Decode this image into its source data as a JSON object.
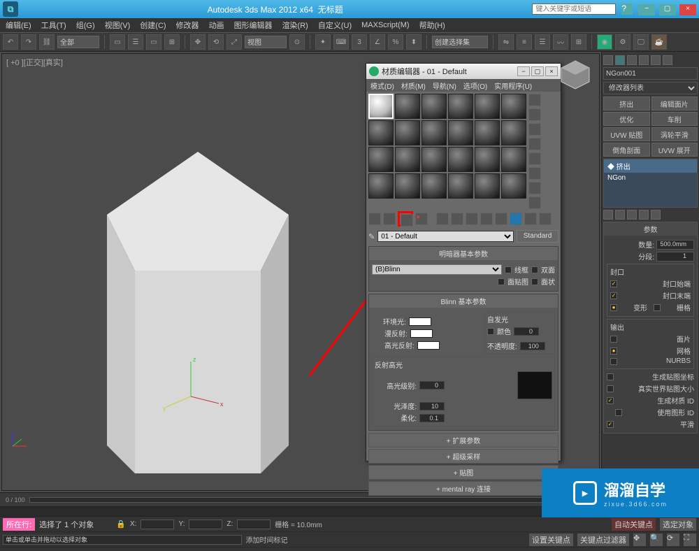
{
  "titlebar": {
    "app": "Autodesk 3ds Max  2012 x64",
    "doc": "无标题",
    "search_placeholder": "键入关键字或短语"
  },
  "menu": [
    "编辑(E)",
    "工具(T)",
    "组(G)",
    "视图(V)",
    "创建(C)",
    "修改器",
    "动画",
    "图形编辑器",
    "渲染(R)",
    "自定义(U)",
    "MAXScript(M)",
    "帮助(H)"
  ],
  "toolbar": {
    "selset_label": "全部",
    "dropdown": "创建选择集",
    "view_btn": "视图"
  },
  "viewport": {
    "label": "[ +0 ][正交][真实]"
  },
  "side": {
    "objname": "NGon001",
    "modlist_label": "修改器列表",
    "btns": [
      [
        "挤出",
        "编辑面片"
      ],
      [
        "优化",
        "车削"
      ],
      [
        "UVW 贴图",
        "涡轮平滑"
      ],
      [
        "倒角剖面",
        "UVW 展开"
      ]
    ],
    "stack": [
      "挤出",
      "NGon"
    ],
    "params_title": "参数",
    "amount_label": "数量:",
    "amount_val": "500.0mm",
    "segments_label": "分段:",
    "segments_val": "1",
    "cap_title": "封口",
    "cap_start": "封口始端",
    "cap_end": "封口末端",
    "morph": "变形",
    "grid": "栅格",
    "output_title": "输出",
    "out_patch": "面片",
    "out_mesh": "网格",
    "out_nurbs": "NURBS",
    "gen_map": "生成贴图坐标",
    "real_world": "真实世界贴图大小",
    "gen_mat": "生成材质 ID",
    "use_shape": "使用图形 ID",
    "smooth": "平滑"
  },
  "mat": {
    "title": "材质编辑器 - 01 - Default",
    "menu": [
      "模式(D)",
      "材质(M)",
      "导航(N)",
      "选项(O)",
      "实用程序(U)"
    ],
    "name": "01 - Default",
    "std_btn": "Standard",
    "shader_roll": "明暗器基本参数",
    "shader": "(B)Blinn",
    "wire": "线框",
    "twoside": "双面",
    "facemap": "面贴图",
    "faceted": "面状",
    "blinn_roll": "Blinn 基本参数",
    "ambient": "环境光:",
    "diffuse": "漫反射:",
    "spec": "高光反射:",
    "selfillum_title": "自发光",
    "color_lbl": "颜色",
    "selfillum_val": "0",
    "opacity_lbl": "不透明度:",
    "opacity_val": "100",
    "spechl_title": "反射高光",
    "speclvl": "高光级别:",
    "speclvl_val": "0",
    "gloss": "光泽度:",
    "gloss_val": "10",
    "soft": "柔化:",
    "soft_val": "0.1",
    "roll_ext": "扩展参数",
    "roll_super": "超级采样",
    "roll_map": "贴图",
    "roll_mr": "mental ray 连接"
  },
  "bottom": {
    "frame_range": "0 / 100",
    "sel_msg": "选择了 1 个对象",
    "hint": "单击或单击并拖动以选择对象",
    "loc_btn": "所在行:",
    "x": "X:",
    "y": "Y:",
    "z": "Z:",
    "grid": "栅格 = 10.0mm",
    "autokey": "自动关键点",
    "selkey": "选定对象",
    "setkey": "设置关键点",
    "keyfilter": "关键点过滤器",
    "add_time": "添加时间标记"
  },
  "watermark": {
    "brand": "溜溜自学",
    "url": "zixue.3d66.com"
  }
}
